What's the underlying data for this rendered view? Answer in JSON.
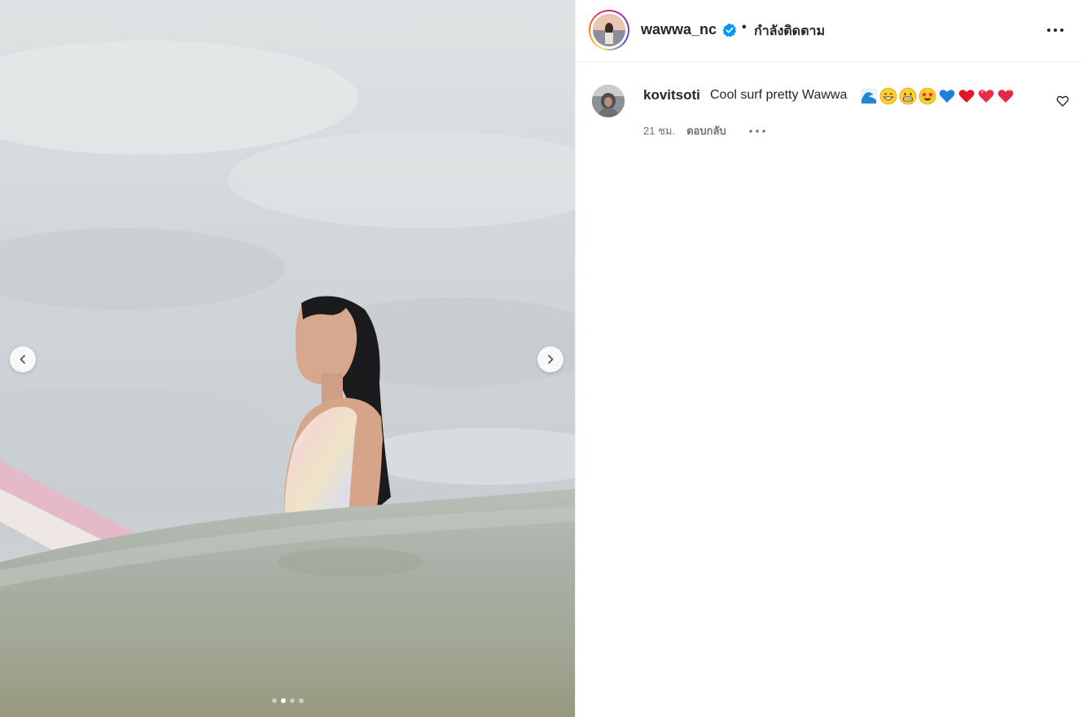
{
  "post": {
    "username": "wawwa_nc",
    "separator": "•",
    "follow_status": "กำลังติดตาม",
    "carousel": {
      "total_slides": 4,
      "active_slide": 2
    }
  },
  "comments": [
    {
      "username": "kovitsoti",
      "text": "Cool surf pretty Wawwa",
      "emojis": [
        "water-wave",
        "beaming-face",
        "grinning-squinting-face",
        "star-struck",
        "blue-heart",
        "red-heart",
        "red-heart",
        "sparkling-heart"
      ],
      "time": "21 ชม.",
      "reply_label": "ตอบกลับ"
    }
  ],
  "colors": {
    "verified_blue": "#0095f6",
    "text_primary": "#262626",
    "text_secondary": "#737373",
    "divider": "#efefef"
  }
}
